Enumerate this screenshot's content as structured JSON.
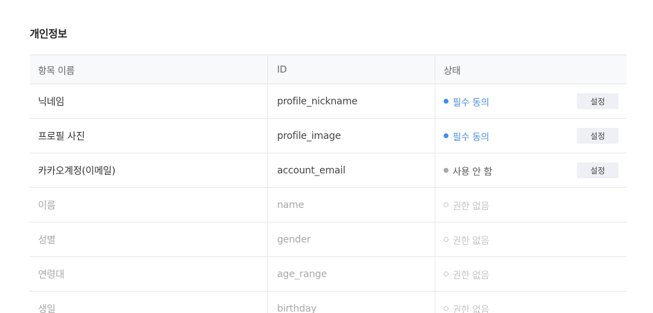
{
  "section": {
    "title": "개인정보"
  },
  "table": {
    "headers": {
      "name": "항목 이름",
      "id": "ID",
      "status": "상태"
    },
    "rows": [
      {
        "name": "닉네임",
        "id": "profile_nickname",
        "status": "필수 동의",
        "status_type": "required",
        "button": "설정"
      },
      {
        "name": "프로필 사진",
        "id": "profile_image",
        "status": "필수 동의",
        "status_type": "required",
        "button": "설정"
      },
      {
        "name": "카카오계정(이메일)",
        "id": "account_email",
        "status": "사용 안 함",
        "status_type": "unused",
        "button": "설정"
      },
      {
        "name": "이름",
        "id": "name",
        "status": "권한 없음",
        "status_type": "none"
      },
      {
        "name": "성별",
        "id": "gender",
        "status": "권한 없음",
        "status_type": "none"
      },
      {
        "name": "연령대",
        "id": "age_range",
        "status": "권한 없음",
        "status_type": "none"
      },
      {
        "name": "생일",
        "id": "birthday",
        "status": "권한 없음",
        "status_type": "none"
      }
    ]
  },
  "colors": {
    "required": "#3d8ff0",
    "unused": "#a6a6a6",
    "none": "#c8c8c8",
    "header_bg": "#f8f9fa",
    "button_bg": "#eef0f5"
  }
}
